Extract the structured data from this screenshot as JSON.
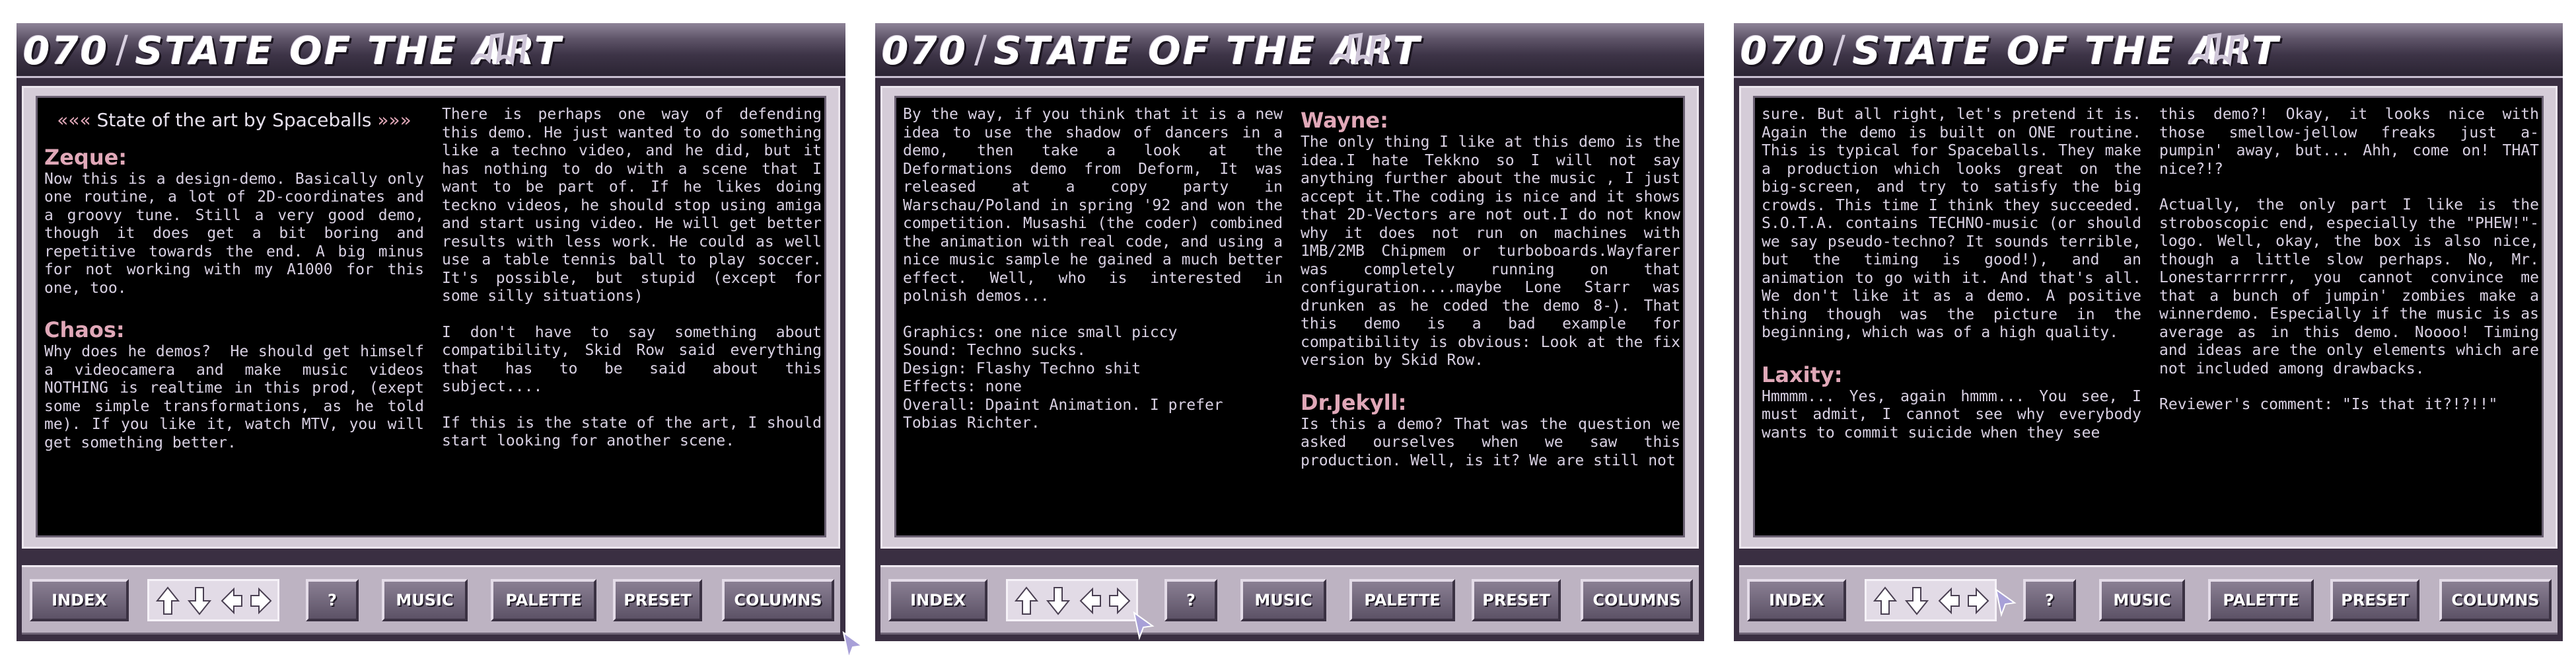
{
  "common": {
    "issue": "070",
    "title": "STATE OF THE ART",
    "buttons": {
      "index": "INDEX",
      "help": "?",
      "music": "MUSIC",
      "palette": "PALETTE",
      "preset": "PRESET",
      "columns": "COLUMNS"
    },
    "icons": [
      "arrow-up-icon",
      "arrow-down-icon",
      "arrow-left-icon",
      "arrow-right-icon"
    ],
    "colors": {
      "text": "#d8d0e2",
      "heading": "#e0a8b8",
      "screen": "#000000",
      "frame": "#d5ccd8"
    }
  },
  "panel1": {
    "intro_quotes_left": "«",
    "intro_quotes_right": "»",
    "intro": "State of the art by Spaceballs",
    "zeque_head": "Zeque:",
    "zeque_text": "Now this is a design-demo. Basically only one routine, a lot of 2D-coordinates and a groovy tune. Still a very good demo, though it does get a bit boring and repetitive towards the end. A big minus for not working with my A1000 for this one, too.",
    "chaos_head": "Chaos:",
    "chaos_text": "Why does he demos?  He should get himself a videocamera and make music videos NOTHING is realtime in this prod, (exept some simple transformations, as he told me). If you like it, watch MTV, you will get something better.",
    "right_p1": "There is perhaps one way of defending this demo. He just wanted to do something like a techno video, and he did, but it has nothing to do with a scene that I want to be part of. If he likes doing teckno videos, he should stop using amiga and start using video. He will get better results with less work. He could as well use a table tennis ball to play soccer. It's possible, but stupid (except for some silly situations)",
    "right_p2": "I don't have to say something about compatibility, Skid Row said everything that has to be said about this subject....",
    "right_p3": "If this is the state of the art, I should start looking for another scene."
  },
  "panel2": {
    "left_p1": "By the way, if you think that it is a new idea to use the shadow of dancers in a demo, then take a look at the Deformations demo from Deform, It was released at a copy party in Warschau/Poland in spring '92 and won the competition. Musashi (the coder) combined the animation with real code, and using a nice music sample he gained a much better effect. Well, who is interested in polnish demos...",
    "credits": "Graphics: one nice small piccy\nSound: Techno sucks.\nDesign: Flashy Techno shit\nEffects: none\nOverall: Dpaint Animation. I prefer Tobias Richter.",
    "wayne_head": "Wayne:",
    "wayne_text": "The only thing I like at this demo is the idea.I hate Tekkno so I will not say anything further about the music , I just accept it.The coding is nice and it shows that 2D-Vectors are not out.I do not know why it does not run on machines with 1MB/2MB Chipmem or turboboards.Wayfarer was completely running on that configuration....maybe Lone Starr was drunken as he coded the demo 8-). That this demo is a bad example for compatibility is obvious: Look at the fix version by Skid Row.",
    "jekyll_head": "Dr.Jekyll:",
    "jekyll_text": "Is this a demo? That was the question we asked ourselves when we saw this production. Well, is it? We are still not"
  },
  "panel3": {
    "left_p1": "sure. But all right, let's pretend it is. Again the demo is built on ONE routine. This is typical for Spaceballs. They make a production which looks great on the big-screen, and try to satisfy the big crowds. This time I think they succeeded. S.O.T.A. contains TECHNO-music (or should we say pseudo-techno? It sounds terrible, but the timing is good!), and an animation to go with it. And that's all. We don't like it as a demo. A positive thing though was the picture in the beginning, which was of a high quality.",
    "laxity_head": "Laxity:",
    "laxity_text": "Hmmmm... Yes, again hmmm... You see, I must admit, I cannot see why everybody wants to commit suicide when they see",
    "right_p1": "this demo?! Okay, it looks nice with those smellow-jellow freaks just a-pumpin' away, but... Ahh, come on! THAT nice?!?",
    "right_p2": "Actually, the only part I like is the stroboscopic end, especially the \"PHEW!\"-logo. Well, okay, the box is also nice, though a little slow perhaps. No, Mr. Lonestarrrrrrr, you cannot convince me that a bunch of jumpin' zombies make a winnerdemo. Especially if the music is as average as in this demo. Noooo! Timing and ideas are the only elements which are not included among drawbacks.",
    "right_p3": "Reviewer's comment: \"Is that it?!?!!\""
  }
}
